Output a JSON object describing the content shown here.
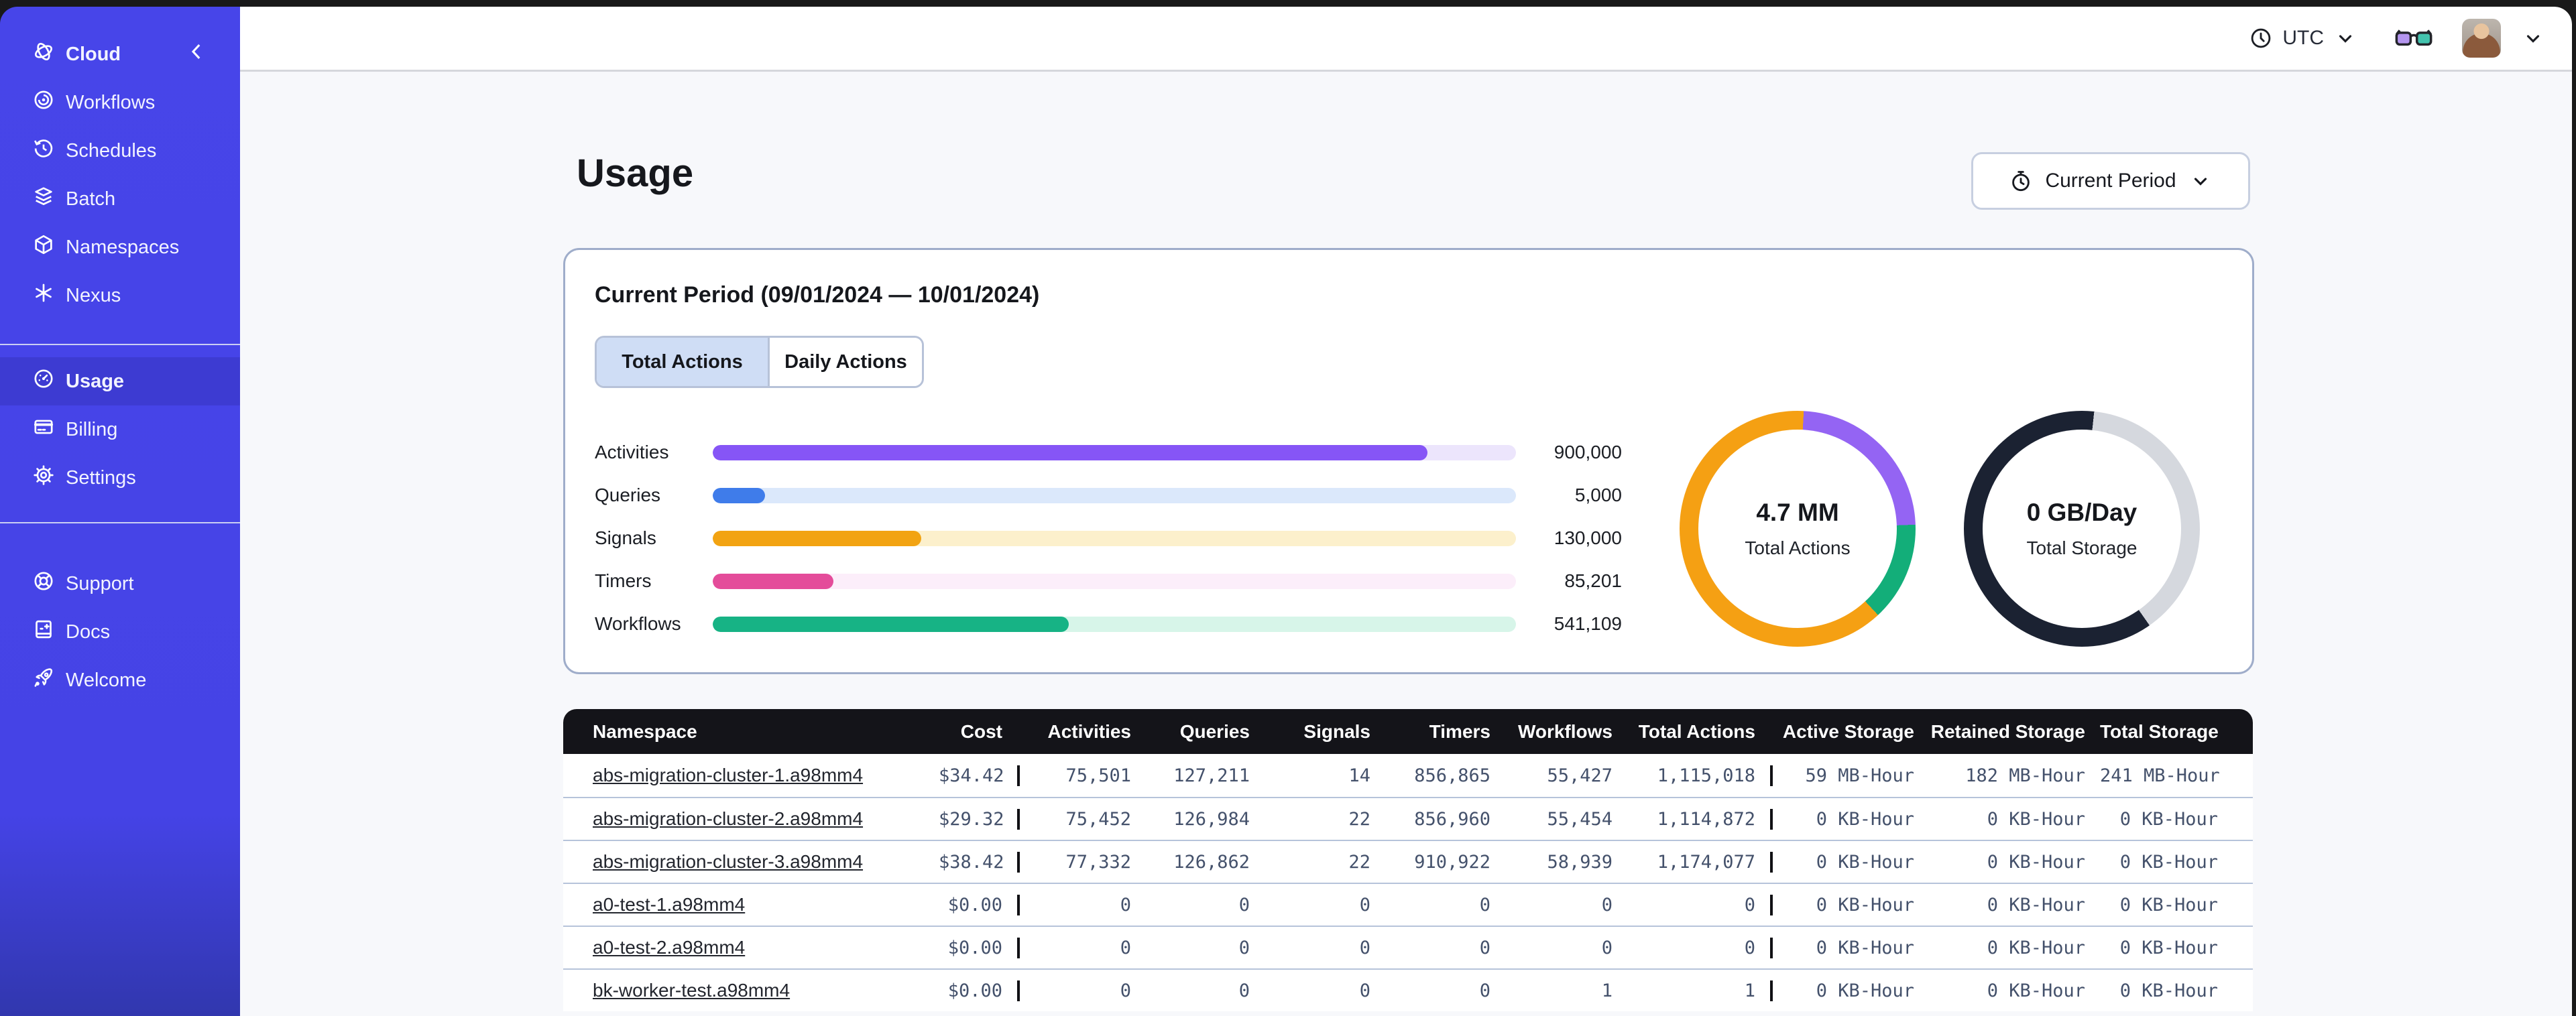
{
  "header": {
    "timezone": "UTC"
  },
  "sidebar": {
    "brand": {
      "label": "Cloud"
    },
    "groups": [
      {
        "items": [
          {
            "label": "Workflows"
          },
          {
            "label": "Schedules"
          },
          {
            "label": "Batch"
          },
          {
            "label": "Namespaces"
          },
          {
            "label": "Nexus"
          }
        ]
      },
      {
        "items": [
          {
            "label": "Usage",
            "active": true
          },
          {
            "label": "Billing"
          },
          {
            "label": "Settings"
          }
        ]
      },
      {
        "items": [
          {
            "label": "Support"
          },
          {
            "label": "Docs"
          },
          {
            "label": "Welcome"
          }
        ]
      }
    ]
  },
  "page": {
    "title": "Usage",
    "period_button": {
      "label": "Current Period"
    }
  },
  "usage_card": {
    "title": "Current Period (09/01/2024 — 10/01/2024)",
    "tabs": [
      {
        "label": "Total Actions",
        "active": true
      },
      {
        "label": "Daily Actions",
        "active": false
      }
    ]
  },
  "chart_data": {
    "bars": {
      "type": "bar",
      "items": [
        {
          "label": "Activities",
          "value": 900000,
          "value_label": "900,000",
          "fraction": 0.89,
          "color": "#8655f6",
          "track": "#ece5fc"
        },
        {
          "label": "Queries",
          "value": 5000,
          "value_label": "5,000",
          "fraction": 0.065,
          "color": "#3f7cea",
          "track": "#dbe8fb"
        },
        {
          "label": "Signals",
          "value": 130000,
          "value_label": "130,000",
          "fraction": 0.26,
          "color": "#f2a312",
          "track": "#fcf0cc"
        },
        {
          "label": "Timers",
          "value": 85201,
          "value_label": "85,201",
          "fraction": 0.15,
          "color": "#e44c9a",
          "track": "#fceefa"
        },
        {
          "label": "Workflows",
          "value": 541109,
          "value_label": "541,109",
          "fraction": 0.443,
          "color": "#17b385",
          "track": "#d7f5e9"
        }
      ]
    },
    "donuts": [
      {
        "type": "pie",
        "title": "Total Actions",
        "center_value": "4.7 MM",
        "center_caption": "Total Actions",
        "segments": [
          {
            "name": "purple",
            "color": "#9464f3",
            "from_deg": 3,
            "to_deg": 88,
            "pct": 23.6
          },
          {
            "name": "green",
            "color": "#13ae79",
            "from_deg": 88,
            "to_deg": 137,
            "pct": 13.6
          },
          {
            "name": "orange",
            "color": "#f5a013",
            "from_deg": 137,
            "to_deg": 363,
            "pct": 62.8
          }
        ]
      },
      {
        "type": "pie",
        "title": "Total Storage",
        "center_value": "0 GB/Day",
        "center_caption": "Total Storage",
        "segments": [
          {
            "name": "gray",
            "color": "#d5d8de",
            "from_deg": 6,
            "to_deg": 145,
            "pct": 38.6
          },
          {
            "name": "navy",
            "color": "#1b2232",
            "from_deg": 145,
            "to_deg": 366,
            "pct": 61.4
          }
        ]
      }
    ]
  },
  "table": {
    "columns": [
      "Namespace",
      "Cost",
      "Activities",
      "Queries",
      "Signals",
      "Timers",
      "Workflows",
      "Total Actions",
      "Active Storage",
      "Retained Storage",
      "Total Storage"
    ],
    "rows": [
      {
        "namespace": "abs-migration-cluster-1.a98mm4",
        "cost": "$34.42",
        "activities": "75,501",
        "queries": "127,211",
        "signals": "14",
        "timers": "856,865",
        "workflows": "55,427",
        "total_actions": "1,115,018",
        "active_storage": "59 MB-Hour",
        "retained_storage": "182 MB-Hour",
        "total_storage": "241 MB-Hour"
      },
      {
        "namespace": "abs-migration-cluster-2.a98mm4",
        "cost": "$29.32",
        "activities": "75,452",
        "queries": "126,984",
        "signals": "22",
        "timers": "856,960",
        "workflows": "55,454",
        "total_actions": "1,114,872",
        "active_storage": "0 KB-Hour",
        "retained_storage": "0 KB-Hour",
        "total_storage": "0 KB-Hour"
      },
      {
        "namespace": "abs-migration-cluster-3.a98mm4",
        "cost": "$38.42",
        "activities": "77,332",
        "queries": "126,862",
        "signals": "22",
        "timers": "910,922",
        "workflows": "58,939",
        "total_actions": "1,174,077",
        "active_storage": "0 KB-Hour",
        "retained_storage": "0 KB-Hour",
        "total_storage": "0 KB-Hour"
      },
      {
        "namespace": "a0-test-1.a98mm4",
        "cost": "$0.00",
        "activities": "0",
        "queries": "0",
        "signals": "0",
        "timers": "0",
        "workflows": "0",
        "total_actions": "0",
        "active_storage": "0 KB-Hour",
        "retained_storage": "0 KB-Hour",
        "total_storage": "0 KB-Hour"
      },
      {
        "namespace": "a0-test-2.a98mm4",
        "cost": "$0.00",
        "activities": "0",
        "queries": "0",
        "signals": "0",
        "timers": "0",
        "workflows": "0",
        "total_actions": "0",
        "active_storage": "0 KB-Hour",
        "retained_storage": "0 KB-Hour",
        "total_storage": "0 KB-Hour"
      },
      {
        "namespace": "bk-worker-test.a98mm4",
        "cost": "$0.00",
        "activities": "0",
        "queries": "0",
        "signals": "0",
        "timers": "0",
        "workflows": "1",
        "total_actions": "1",
        "active_storage": "0 KB-Hour",
        "retained_storage": "0 KB-Hour",
        "total_storage": "0 KB-Hour"
      }
    ]
  }
}
